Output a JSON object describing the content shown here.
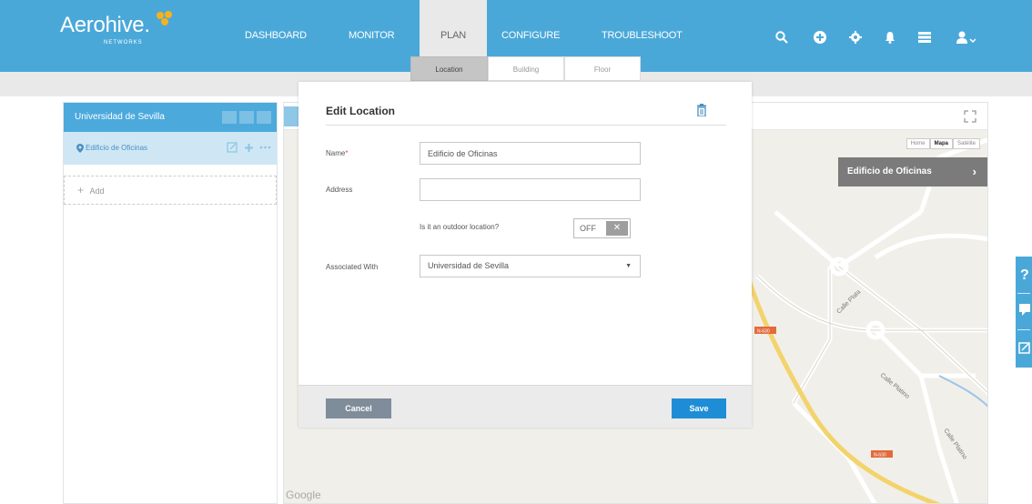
{
  "brand": {
    "name": "Aerohive.",
    "sub": "NETWORKS"
  },
  "nav": {
    "items": [
      {
        "label": "DASHBOARD"
      },
      {
        "label": "MONITOR"
      },
      {
        "label": "PLAN"
      },
      {
        "label": "CONFIGURE"
      },
      {
        "label": "TROUBLESHOOT"
      }
    ],
    "active": "PLAN",
    "icons": [
      "search-icon",
      "add-circle-icon",
      "gear-icon",
      "bell-icon",
      "server-list-icon",
      "user-icon"
    ]
  },
  "subtabs": [
    {
      "label": "Location",
      "active": true
    },
    {
      "label": "Building",
      "active": false
    },
    {
      "label": "Floor",
      "active": false
    }
  ],
  "sidebar": {
    "title": "Universidad de Sevilla",
    "item": "Edificio de Oficinas",
    "add_label": "Add"
  },
  "map": {
    "map_types": [
      "Home",
      "Mapa",
      "Satélite"
    ],
    "selected_type": "Mapa",
    "location_banner": "Edificio de Oficinas",
    "google_label": "Google",
    "road_labels": [
      "Calle Plata",
      "Calle Platino",
      "Calle Platino",
      "N-630",
      "N-630"
    ]
  },
  "modal": {
    "title": "Edit Location",
    "name_label": "Name",
    "name_value": "Edificio de Oficinas",
    "address_label": "Address",
    "address_value": "",
    "outdoor_question": "Is it an outdoor location?",
    "outdoor_toggle": "OFF",
    "associated_label": "Associated With",
    "associated_value": "Universidad de Sevilla",
    "cancel_label": "Cancel",
    "save_label": "Save"
  },
  "colors": {
    "nav_bg": "#4aa8d9",
    "save_button": "#1f8dd6",
    "cancel_button": "#7f8c9a",
    "banner": "#7b7b7b"
  }
}
